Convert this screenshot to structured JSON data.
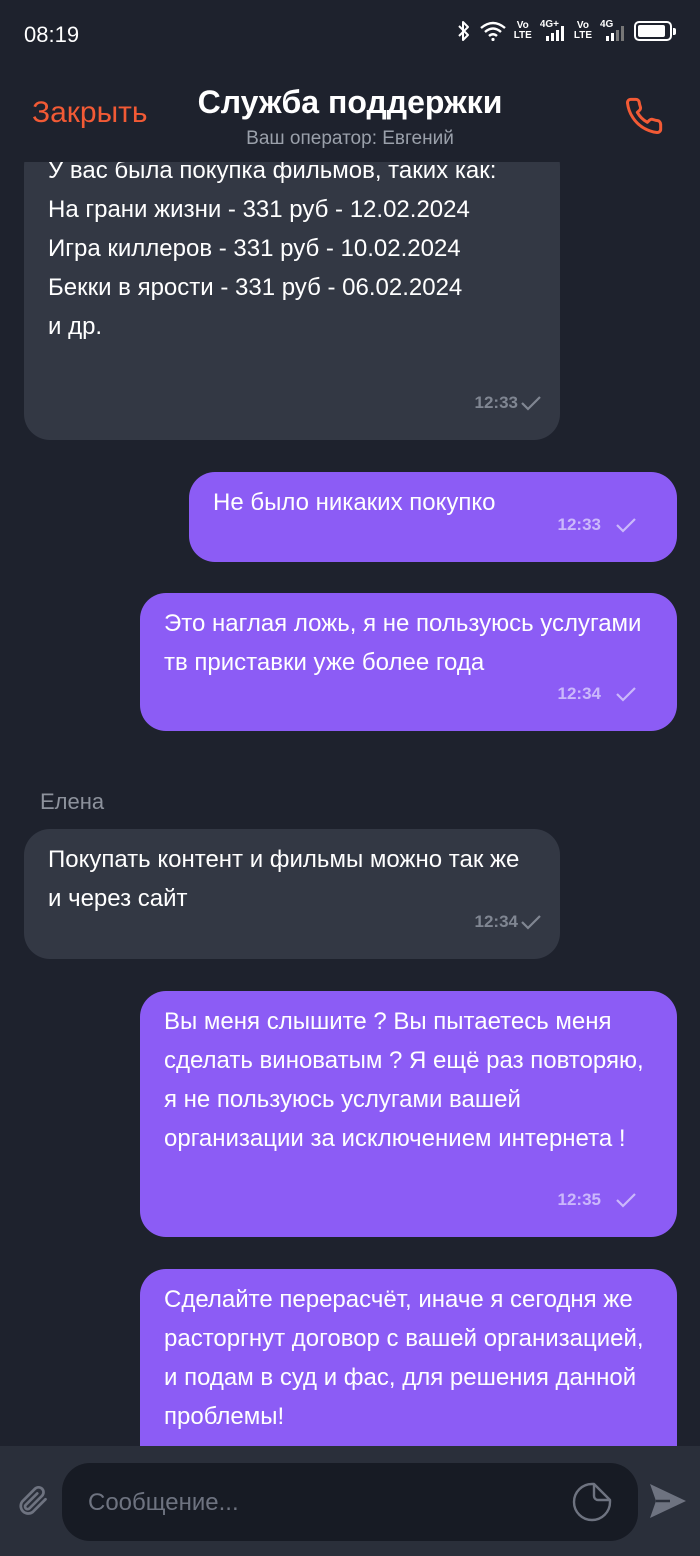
{
  "status_bar": {
    "time": "08:19",
    "sim1_tag_top": "Vo",
    "sim1_tag_bottom": "LTE",
    "sim1_network": "4G+",
    "sim2_tag_top": "Vo",
    "sim2_tag_bottom": "LTE",
    "sim2_network": "4G",
    "battery_level": 0.9
  },
  "header": {
    "close_label": "Закрыть",
    "title": "Служба поддержки",
    "subtitle": "Ваш оператор: Евгений"
  },
  "messages": [
    {
      "text": "У вас была покупка фильмов, таких как:\nНа грани жизни - 331 руб - 12.02.2024\nИгра киллеров - 331 руб - 10.02.2024\nБекки в ярости - 331 руб - 06.02.2024\nи др.",
      "time": "12:33"
    },
    {
      "text": "Не было никаких покупко",
      "time": "12:33"
    },
    {
      "text": "Это наглая ложь, я не пользуюсь услугами тв приставки уже более года",
      "time": "12:34"
    },
    {
      "sender": "Елена",
      "text": "Покупать контент и фильмы можно так же и через сайт",
      "time": "12:34"
    },
    {
      "text": "Вы меня слышите ? Вы пытаетесь меня сделать виноватым ? Я ещё раз повторяю, я не пользуюсь услугами вашей организации за исключением интернета !",
      "time": "12:35"
    },
    {
      "text": "Сделайте перерасчёт, иначе я сегодня же расторгнут договор с вашей организацией, и подам в суд и фас, для решения данной проблемы!",
      "time": ""
    }
  ],
  "input": {
    "placeholder": "Сообщение..."
  },
  "colors": {
    "background": "#1e222d",
    "accent": "#f25a35",
    "incoming_bubble": "#333844",
    "outgoing_bubble": "#8c5cf5"
  }
}
